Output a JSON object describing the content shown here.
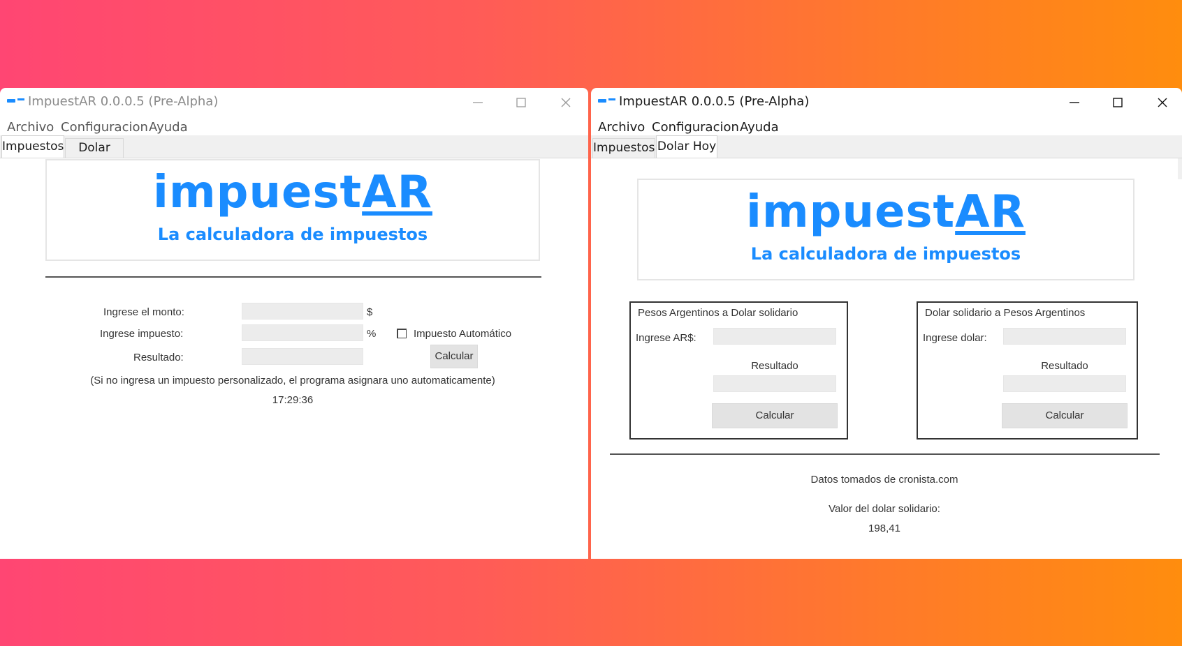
{
  "windows": [
    {
      "title": "ImpuestAR 0.0.0.5 (Pre-Alpha)",
      "menu": [
        "Archivo",
        "Configuracion",
        "Ayuda"
      ],
      "tabs": [
        "Impuestos",
        "Dolar Hoy"
      ],
      "active_tab": "Impuestos",
      "logo": {
        "main_prefix": "impuest",
        "main_suffix": "AR",
        "subtitle": "La calculadora de impuestos"
      },
      "form": {
        "monto_label": "Ingrese el monto:",
        "monto_value": "",
        "monto_unit": "$",
        "impuesto_label": "Ingrese impuesto:",
        "impuesto_value": "",
        "impuesto_unit": "%",
        "auto_checkbox_label": "Impuesto Automático",
        "auto_checked": false,
        "resultado_label": "Resultado:",
        "resultado_value": "",
        "calcular_label": "Calcular",
        "note": "(Si no ingresa un impuesto personalizado, el programa asignara uno automaticamente)",
        "clock": "17:29:36"
      }
    },
    {
      "title": "ImpuestAR 0.0.0.5 (Pre-Alpha)",
      "menu": [
        "Archivo",
        "Configuracion",
        "Ayuda"
      ],
      "tabs": [
        "Impuestos",
        "Dolar Hoy"
      ],
      "active_tab": "Dolar Hoy",
      "logo": {
        "main_prefix": "impuest",
        "main_suffix": "AR",
        "subtitle": "La calculadora de impuestos"
      },
      "converters": [
        {
          "title": "Pesos Argentinos a Dolar solidario",
          "input_label": "Ingrese AR$:",
          "input_value": "",
          "result_label": "Resultado",
          "result_value": "",
          "button_label": "Calcular"
        },
        {
          "title": "Dolar solidario a Pesos Argentinos",
          "input_label": "Ingrese dolar:",
          "input_value": "",
          "result_label": "Resultado",
          "result_value": "",
          "button_label": "Calcular"
        }
      ],
      "source_text": "Datos tomados de cronista.com",
      "rate_label": "Valor del dolar solidario:",
      "rate_value": "198,41"
    }
  ],
  "colors": {
    "brand": "#1a8cff",
    "background_left": "#ff4673",
    "background_right": "#ff8d0e"
  },
  "icons": [
    "app-icon",
    "minimize-icon",
    "maximize-icon",
    "close-icon",
    "checkbox-icon"
  ]
}
